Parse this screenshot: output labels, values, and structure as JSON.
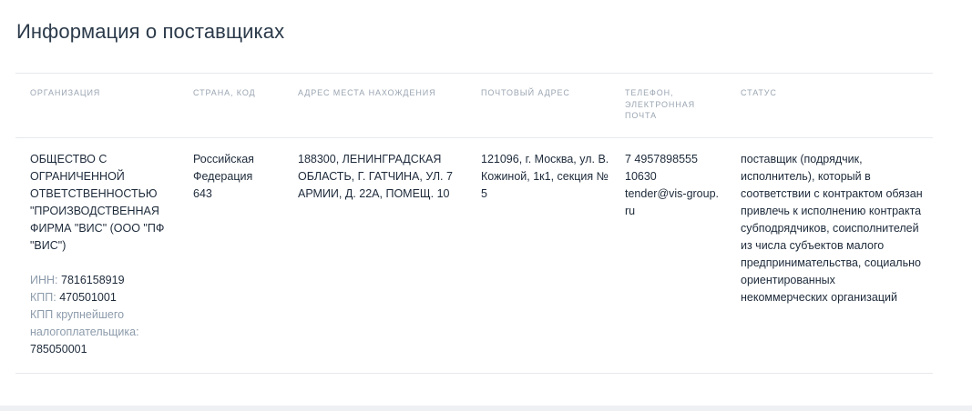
{
  "section": {
    "title": "Информация о поставщиках"
  },
  "table": {
    "headers": {
      "organization": "ОРГАНИЗАЦИЯ",
      "country": "СТРАНА, КОД",
      "location_address": "АДРЕС МЕСТА НАХОЖДЕНИЯ",
      "postal_address": "ПОЧТОВЫЙ АДРЕС",
      "contacts_1": "ТЕЛЕФОН,",
      "contacts_2": "ЭЛЕКТРОННАЯ",
      "contacts_3": "ПОЧТА",
      "status": "СТАТУС"
    },
    "rows": [
      {
        "organization_name": "ОБЩЕСТВО С ОГРАНИЧЕННОЙ ОТВЕТСТВЕННОСТЬЮ \"ПРОИЗВОДСТВЕННАЯ ФИРМА \"ВИС\" (ООО \"ПФ \"ВИС\")",
        "inn_label": "ИНН:",
        "inn_value": "7816158919",
        "kpp_label": "КПП:",
        "kpp_value": "470501001",
        "kpp_large_label": "КПП крупнейшего налогоплательщика:",
        "kpp_large_value": "785050001",
        "country": "Российская Федерация",
        "country_code": "643",
        "location_address": "188300, ЛЕНИНГРАДСКАЯ ОБЛАСТЬ, Г. ГАТЧИНА, УЛ. 7 АРМИИ, Д. 22А, ПОМЕЩ. 10",
        "postal_address": "121096, г. Москва, ул. В. Кожиной, 1к1, секция № 5",
        "phone": "7 4957898555 10630",
        "email": "tender@vis-group.ru",
        "status": "поставщик (подрядчик, исполнитель), который в соответствии с контрактом обязан привлечь к исполнению контракта субподрядчиков, соисполнителей из числа субъектов малого предпринимательства, социально ориентированных некоммерческих организаций"
      }
    ]
  }
}
